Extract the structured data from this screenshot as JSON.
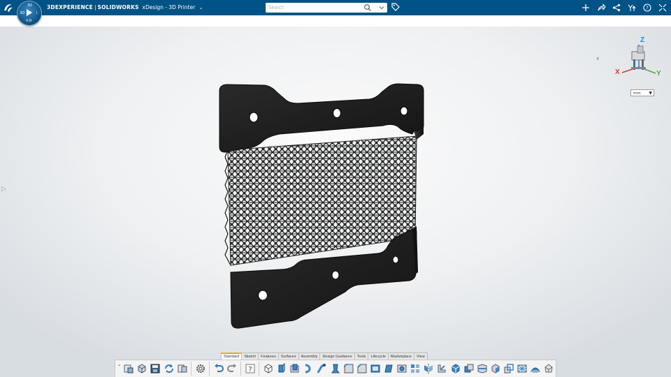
{
  "header": {
    "brand": "3DEXPERIENCE",
    "app": "SOLIDWORKS",
    "document": "xDesign - 3D Printer",
    "compass": {
      "top": "3D",
      "left": "3D",
      "right": "i",
      "bottom": "V,R"
    }
  },
  "search": {
    "placeholder": "Search",
    "value": ""
  },
  "viewport": {
    "units_value": "mm",
    "axes": {
      "x": "X",
      "y": "Y",
      "z": "Z"
    },
    "colors": {
      "x": "#e8332a",
      "y": "#5aa541",
      "z": "#1a8ad4"
    }
  },
  "command_manager": {
    "tabs": [
      "Standard",
      "Sketch",
      "Features",
      "Surfaces",
      "Assembly",
      "Design Guidance",
      "Tools",
      "Lifecycle",
      "Marketplace",
      "View"
    ],
    "active_tab": "Standard",
    "accent": "#f0a22a"
  },
  "colors": {
    "topbar": "#005386",
    "model": "#1f1f1f"
  }
}
